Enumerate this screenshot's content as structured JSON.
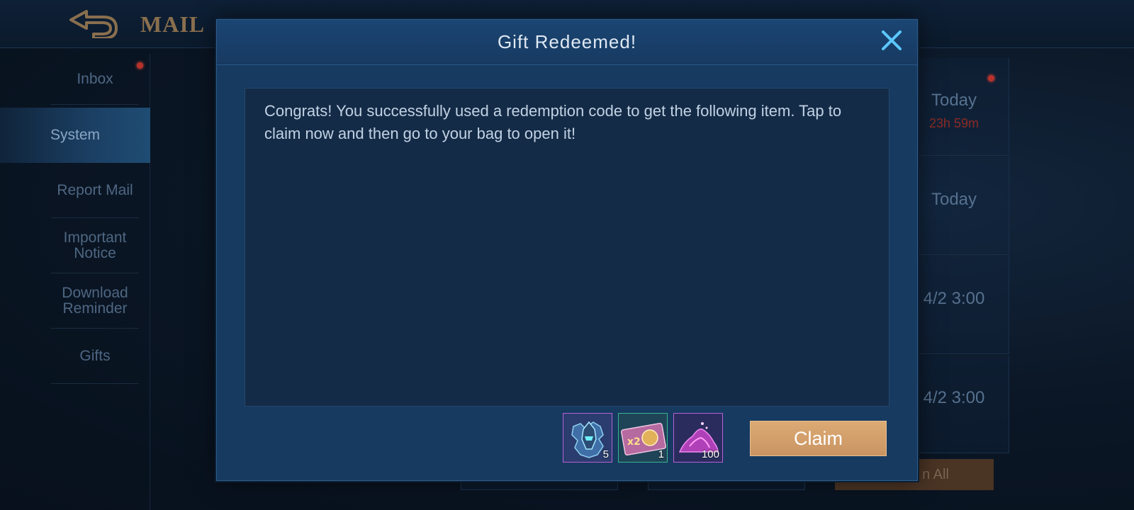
{
  "header": {
    "title": "MAIL"
  },
  "sidebar": {
    "items": [
      {
        "label": "Inbox"
      },
      {
        "label": "System"
      },
      {
        "label": "Report Mail"
      },
      {
        "label": "Important Notice"
      },
      {
        "label": "Download Reminder"
      },
      {
        "label": "Gifts"
      }
    ]
  },
  "mail_list": {
    "items": [
      {
        "date": "Today",
        "timer": "23h 59m"
      },
      {
        "date": "Today",
        "timer": ""
      },
      {
        "date": "4/2 3:00",
        "timer": ""
      },
      {
        "date": "4/2 3:00",
        "timer": ""
      }
    ]
  },
  "footer": {
    "claim_all_label": "n All"
  },
  "modal": {
    "title": "Gift Redeemed!",
    "message": "Congrats! You successfully used a redemption code to get the following item. Tap to claim now and then go to your bag to open it!",
    "rewards": [
      {
        "icon": "hero-fragment-icon",
        "qty": "5"
      },
      {
        "icon": "double-exp-card-icon",
        "qty": "1"
      },
      {
        "icon": "magic-dust-icon",
        "qty": "100"
      }
    ],
    "claim_label": "Claim"
  },
  "colors": {
    "accent_gold": "#c99462",
    "modal_bg": "#173a61",
    "alert_red": "#b8322c",
    "epic_purple": "#b85fd6",
    "rare_green": "#37b58c"
  }
}
